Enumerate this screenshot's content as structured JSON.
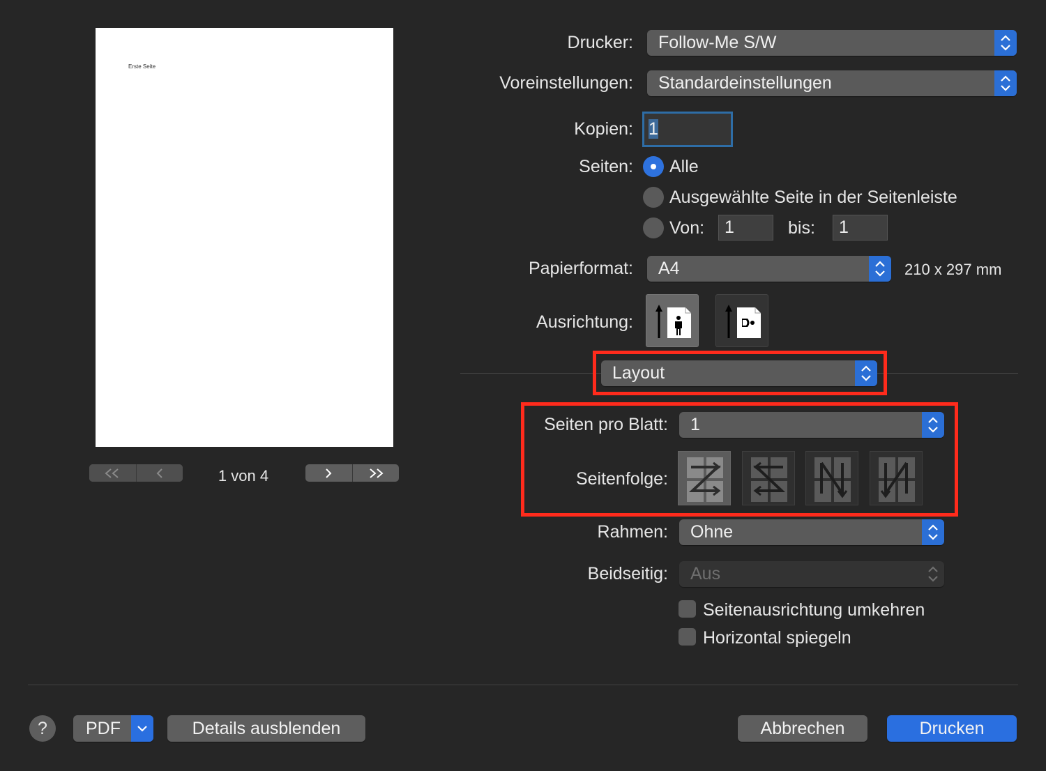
{
  "preview": {
    "page_text": "Erste Seite",
    "page_indicator": "1 von 4",
    "nav_first": "<<",
    "nav_prev": "<",
    "nav_next": ">",
    "nav_last": ">>"
  },
  "printer": {
    "label": "Drucker:",
    "value": "Follow-Me S/W"
  },
  "presets": {
    "label": "Voreinstellungen:",
    "value": "Standardeinstellungen"
  },
  "copies": {
    "label": "Kopien:",
    "value": "1"
  },
  "pages": {
    "label": "Seiten:",
    "option_all": "Alle",
    "option_selected": "Ausgewählte Seite in der Seitenleiste",
    "option_range_from": "Von:",
    "from_value": "1",
    "to_label": "bis:",
    "to_value": "1",
    "selected": "Alle"
  },
  "paper": {
    "label": "Papierformat:",
    "value": "A4",
    "size": "210 x 297 mm"
  },
  "orientation": {
    "label": "Ausrichtung:",
    "selected": "portrait"
  },
  "section": {
    "value": "Layout"
  },
  "layout": {
    "pages_per_sheet_label": "Seiten pro Blatt:",
    "pages_per_sheet_value": "1",
    "sequence_label": "Seitenfolge:",
    "border_label": "Rahmen:",
    "border_value": "Ohne",
    "duplex_label": "Beidseitig:",
    "duplex_value": "Aus",
    "reverse_label": "Seitenausrichtung umkehren",
    "reverse_checked": false,
    "flip_label": "Horizontal spiegeln",
    "flip_checked": false
  },
  "footer": {
    "help": "?",
    "pdf": "PDF",
    "hide_details": "Details ausblenden",
    "cancel": "Abbrechen",
    "print": "Drucken"
  },
  "colors": {
    "accent": "#2a6fe0",
    "highlight": "#ff2b1c",
    "background": "#262626"
  }
}
